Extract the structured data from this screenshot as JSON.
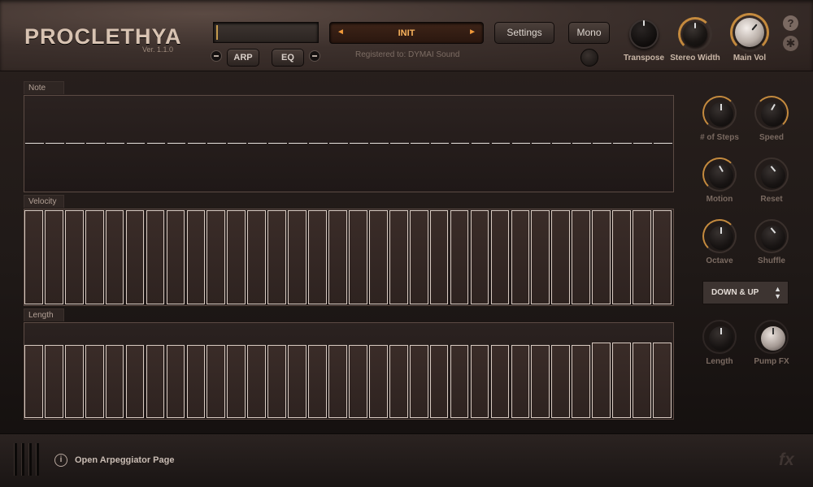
{
  "header": {
    "logo": "PROCLETHYA",
    "version": "Ver. 1.1.0",
    "arp_label": "ARP",
    "eq_label": "EQ",
    "preset_name": "INIT",
    "preset_prev": "◄",
    "preset_next": "►",
    "registered": "Registered to: DYMAI Sound",
    "settings_label": "Settings",
    "mono_label": "Mono",
    "help_glyph": "?",
    "gear_glyph": "✱",
    "knobs": [
      {
        "name": "transpose",
        "label": "Transpose",
        "value": 0.5
      },
      {
        "name": "stereo-width",
        "label": "Stereo Width",
        "value": 0.5
      },
      {
        "name": "main-vol",
        "label": "Main Vol",
        "value": 0.7
      }
    ]
  },
  "sequencer": {
    "steps": 32,
    "note_label": "Note",
    "velocity_label": "Velocity",
    "length_label": "Length",
    "velocity_values": [
      1,
      1,
      1,
      1,
      1,
      1,
      1,
      1,
      1,
      1,
      1,
      1,
      1,
      1,
      1,
      1,
      1,
      1,
      1,
      1,
      1,
      1,
      1,
      1,
      1,
      1,
      1,
      1,
      1,
      1,
      1,
      1
    ],
    "length_values": [
      0.78,
      0.78,
      0.78,
      0.78,
      0.78,
      0.78,
      0.78,
      0.78,
      0.78,
      0.78,
      0.78,
      0.78,
      0.78,
      0.78,
      0.78,
      0.78,
      0.78,
      0.78,
      0.78,
      0.78,
      0.78,
      0.78,
      0.78,
      0.78,
      0.78,
      0.78,
      0.78,
      0.78,
      0.8,
      0.8,
      0.8,
      0.8
    ]
  },
  "side": {
    "knobs": [
      {
        "name": "num-steps",
        "label": "# of Steps"
      },
      {
        "name": "speed",
        "label": "Speed"
      },
      {
        "name": "motion",
        "label": "Motion"
      },
      {
        "name": "reset",
        "label": "Reset"
      },
      {
        "name": "octave",
        "label": "Octave"
      },
      {
        "name": "shuffle",
        "label": "Shuffle"
      }
    ],
    "direction": "DOWN & UP",
    "length_label": "Length",
    "pump_label": "Pump FX"
  },
  "footer": {
    "info_glyph": "i",
    "message": "Open Arpeggiator Page",
    "fx_logo": "fx"
  },
  "colors": {
    "accent": "#c48a3e",
    "preset_text": "#f7b25c",
    "bar_stroke": "#d9cbc2"
  }
}
